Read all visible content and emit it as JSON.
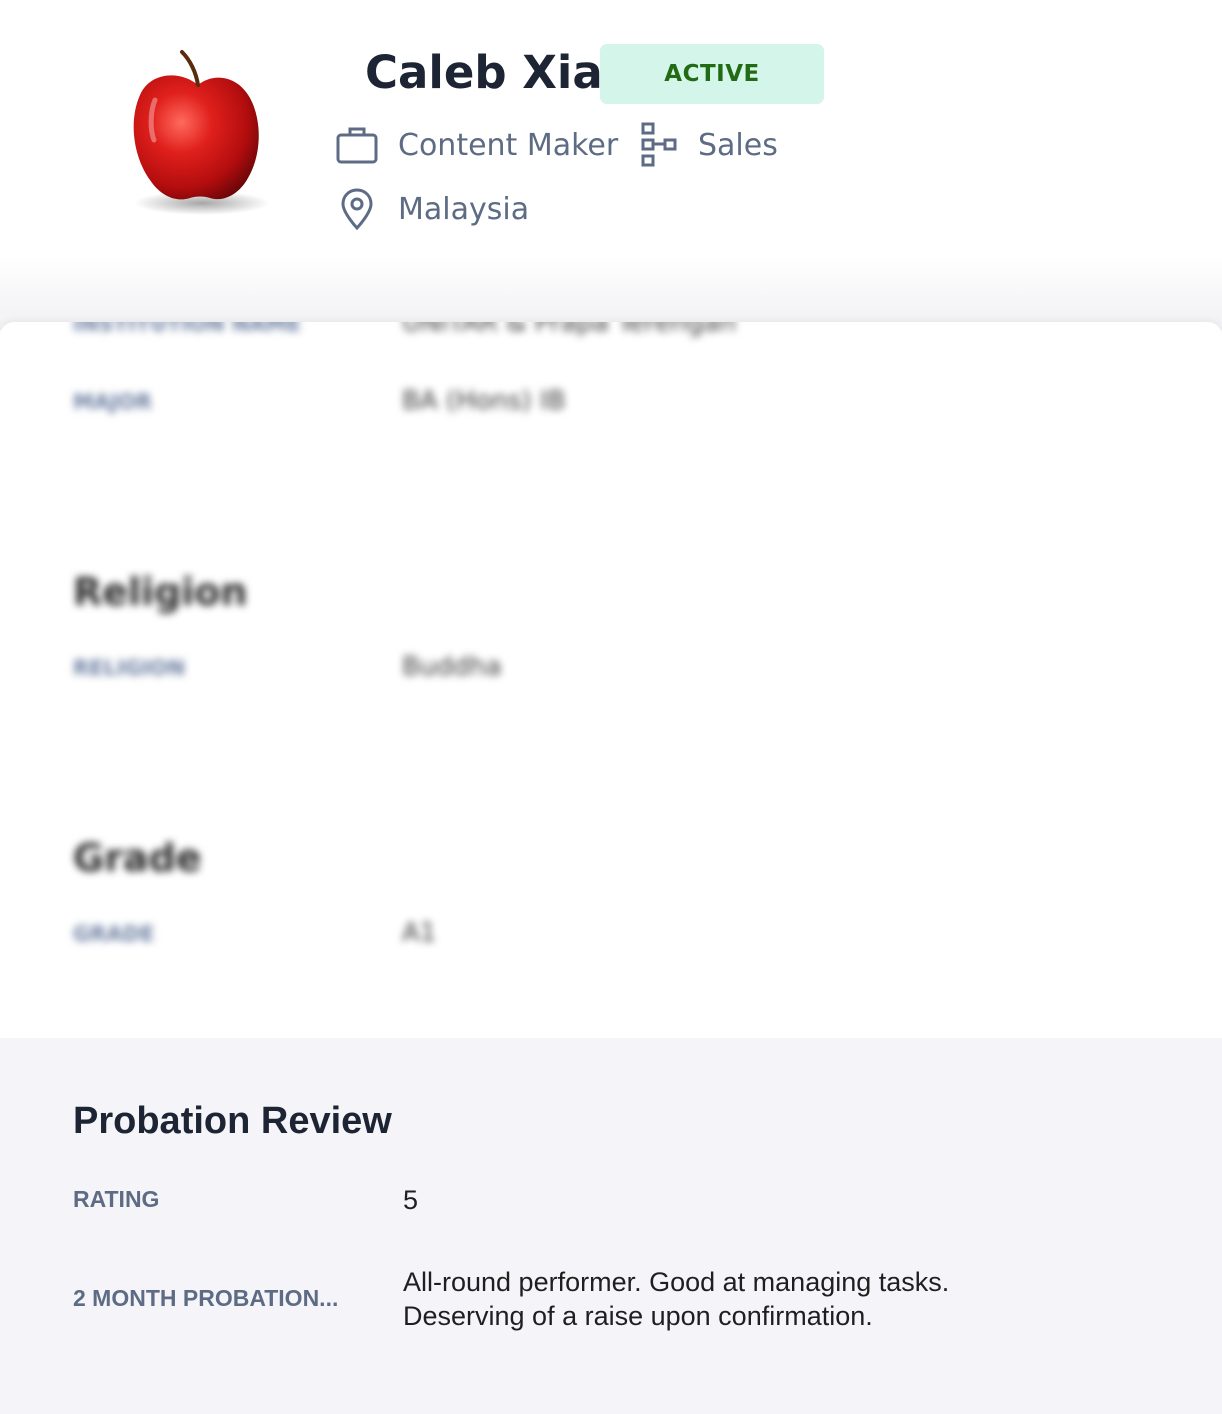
{
  "profile": {
    "name": "Caleb Xia",
    "status": "ACTIVE",
    "role": "Content Maker",
    "department": "Sales",
    "location": "Malaysia",
    "avatar_icon": "apple-avatar"
  },
  "blurred_details": {
    "institution_label": "INSTITUTION NAME",
    "institution_value": "UNITAR & Prapa Terengan",
    "major_label": "MAJOR",
    "major_value": "BA (Hons) IB",
    "religion_title": "Religion",
    "religion_label": "RELIGION",
    "religion_value": "Buddha",
    "grade_title": "Grade",
    "grade_label": "GRADE",
    "grade_value": "A1"
  },
  "probation": {
    "title": "Probation Review",
    "rating_label": "RATING",
    "rating_value": "5",
    "review_label": "2 MONTH PROBATION...",
    "review_line1": "All-round performer. Good at managing tasks.",
    "review_line2": "Deserving of a raise upon confirmation."
  },
  "colors": {
    "badge_bg": "#d3f5ea",
    "badge_text": "#236a14",
    "meta_text": "#5d6c84",
    "section_bg": "#f5f5f9"
  }
}
